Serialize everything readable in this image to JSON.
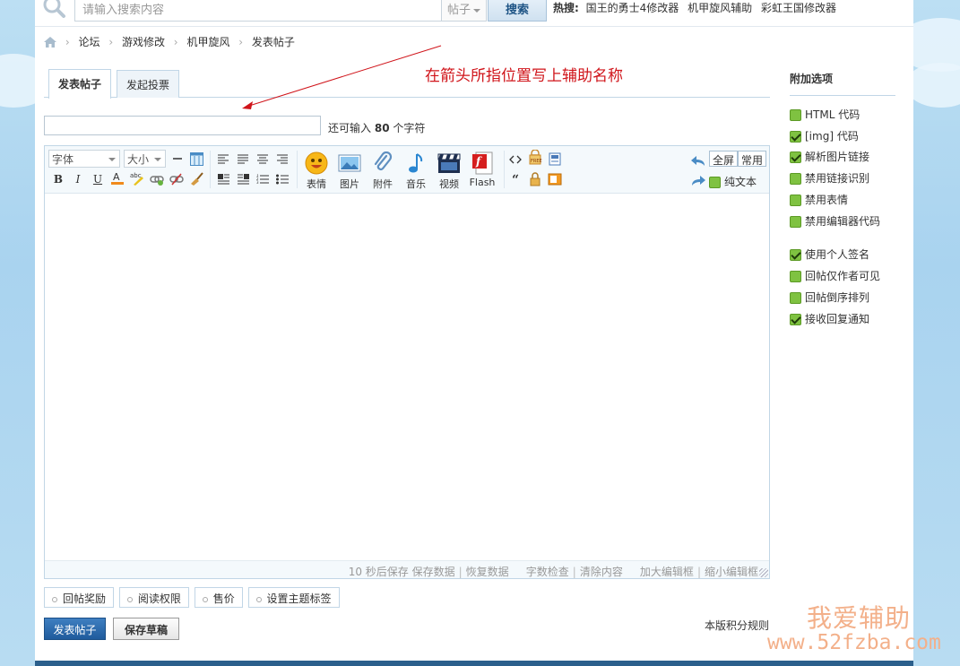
{
  "search": {
    "placeholder": "请输入搜索内容",
    "type_label": "帖子",
    "button_label": "搜索",
    "hot_label": "热搜:",
    "hot_items": [
      "国王的勇士4修改器",
      "机甲旋风辅助",
      "彩虹王国修改器"
    ]
  },
  "breadcrumb": [
    "论坛",
    "游戏修改",
    "机甲旋风",
    "发表帖子"
  ],
  "annotation": "在箭头所指位置写上辅助名称",
  "tabs": [
    "发表帖子",
    "发起投票"
  ],
  "title_input": {
    "value": "",
    "remaining_prefix": "还可输入",
    "remaining_count": "80",
    "remaining_suffix": "个字符"
  },
  "toolbar": {
    "font_label": "字体",
    "size_label": "大小",
    "big_buttons": [
      "表情",
      "图片",
      "附件",
      "音乐",
      "视频",
      "Flash"
    ],
    "fullscreen_label": "全屏",
    "common_label": "常用",
    "plaintext_label": "纯文本"
  },
  "editor_footer": {
    "autosave": "10 秒后保存",
    "save": "保存数据",
    "restore": "恢复数据",
    "word_check": "字数检查",
    "clear": "清除内容",
    "enlarge": "加大编辑框",
    "shrink": "缩小编辑框"
  },
  "extra_buttons": [
    "回帖奖励",
    "阅读权限",
    "售价",
    "设置主题标签"
  ],
  "submit_label": "发表帖子",
  "draft_label": "保存草稿",
  "credit_rules": "本版积分规则",
  "sidebar": {
    "title": "附加选项",
    "options": [
      {
        "label": "HTML 代码",
        "checked": false
      },
      {
        "label": "[img] 代码",
        "checked": true
      },
      {
        "label": "解析图片链接",
        "checked": true
      },
      {
        "label": "禁用链接识别",
        "checked": false
      },
      {
        "label": "禁用表情",
        "checked": false
      },
      {
        "label": "禁用编辑器代码",
        "checked": false
      },
      {
        "label": "使用个人签名",
        "checked": true
      },
      {
        "label": "回帖仅作者可见",
        "checked": false
      },
      {
        "label": "回帖倒序排列",
        "checked": false
      },
      {
        "label": "接收回复通知",
        "checked": true
      }
    ]
  },
  "watermark": {
    "line1": "我爱辅助",
    "line2": "www.52fzba.com"
  },
  "colors": {
    "accent": "#1f5b9c",
    "annotation": "#d0141a",
    "checkbox": "#7fc241",
    "page_bg": "#a9d3ef"
  }
}
